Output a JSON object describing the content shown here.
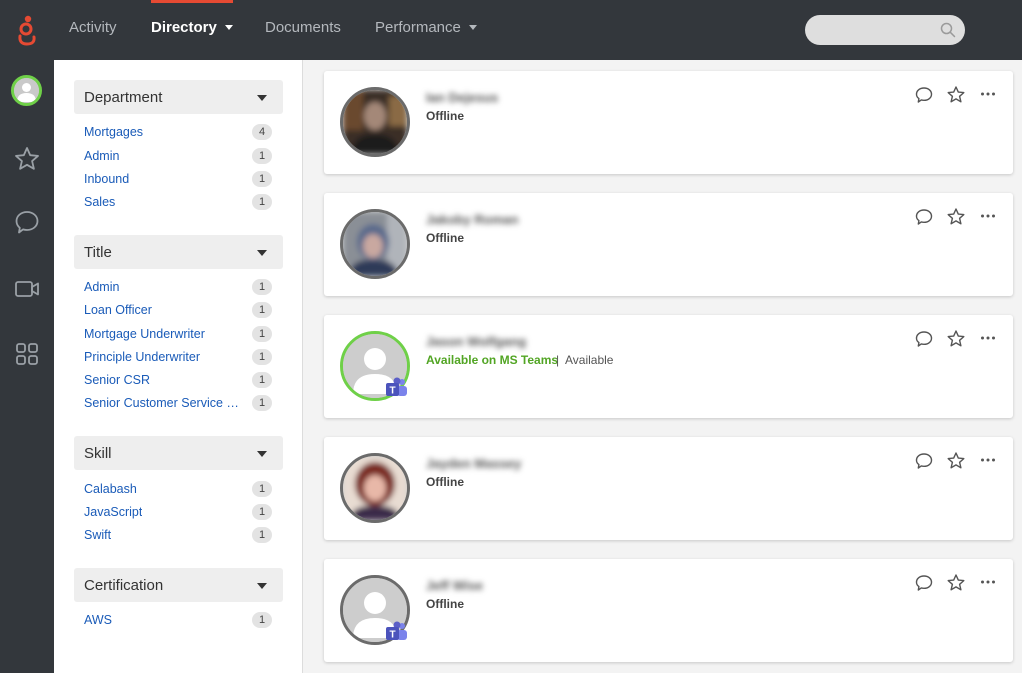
{
  "nav": {
    "items": [
      {
        "label": "Activity",
        "caret": false,
        "active": false
      },
      {
        "label": "Directory",
        "caret": true,
        "active": true
      },
      {
        "label": "Documents",
        "caret": false,
        "active": false
      },
      {
        "label": "Performance",
        "caret": true,
        "active": false
      }
    ],
    "search": {
      "placeholder": "",
      "value": "",
      "icon": "search-icon"
    },
    "accent_color": "#e64a33"
  },
  "rail": {
    "icons": [
      "user-avatar",
      "star-icon",
      "chat-icon",
      "video-icon",
      "apps-icon"
    ],
    "presence_color": "#6fd048"
  },
  "filters": [
    {
      "title": "Department",
      "items": [
        {
          "label": "Mortgages",
          "count": "4"
        },
        {
          "label": "Admin",
          "count": "1"
        },
        {
          "label": "Inbound",
          "count": "1"
        },
        {
          "label": "Sales",
          "count": "1"
        }
      ]
    },
    {
      "title": "Title",
      "items": [
        {
          "label": "Admin",
          "count": "1"
        },
        {
          "label": "Loan Officer",
          "count": "1"
        },
        {
          "label": "Mortgage Underwriter",
          "count": "1"
        },
        {
          "label": "Principle Underwriter",
          "count": "1"
        },
        {
          "label": "Senior CSR",
          "count": "1"
        },
        {
          "label": "Senior Customer Service Re...",
          "count": "1"
        }
      ]
    },
    {
      "title": "Skill",
      "items": [
        {
          "label": "Calabash",
          "count": "1"
        },
        {
          "label": "JavaScript",
          "count": "1"
        },
        {
          "label": "Swift",
          "count": "1"
        }
      ]
    },
    {
      "title": "Certification",
      "items": [
        {
          "label": "AWS",
          "count": "1"
        }
      ]
    }
  ],
  "people": [
    {
      "name": "Ian Dejesus",
      "status": "Offline",
      "presence": "offline",
      "photo": "photo-dark",
      "teams": false
    },
    {
      "name": "Jakoby Roman",
      "status": "Offline",
      "presence": "offline",
      "photo": "photo-blue",
      "teams": false
    },
    {
      "name": "Jason Wolfgang",
      "status": "Available on MS Teams",
      "status_extra": "Available",
      "presence": "available",
      "photo": "placeholder",
      "teams": true
    },
    {
      "name": "Jayden Massey",
      "status": "Offline",
      "presence": "offline",
      "photo": "photo-warm",
      "teams": false
    },
    {
      "name": "Jeff Wise",
      "status": "Offline",
      "presence": "offline",
      "photo": "placeholder",
      "teams": true
    }
  ],
  "card_actions": [
    "chat-icon",
    "favorite-star-icon",
    "more-options-icon"
  ],
  "colors": {
    "link": "#1a5bb8",
    "available": "#52a524",
    "teams": "#5b5fc7"
  }
}
